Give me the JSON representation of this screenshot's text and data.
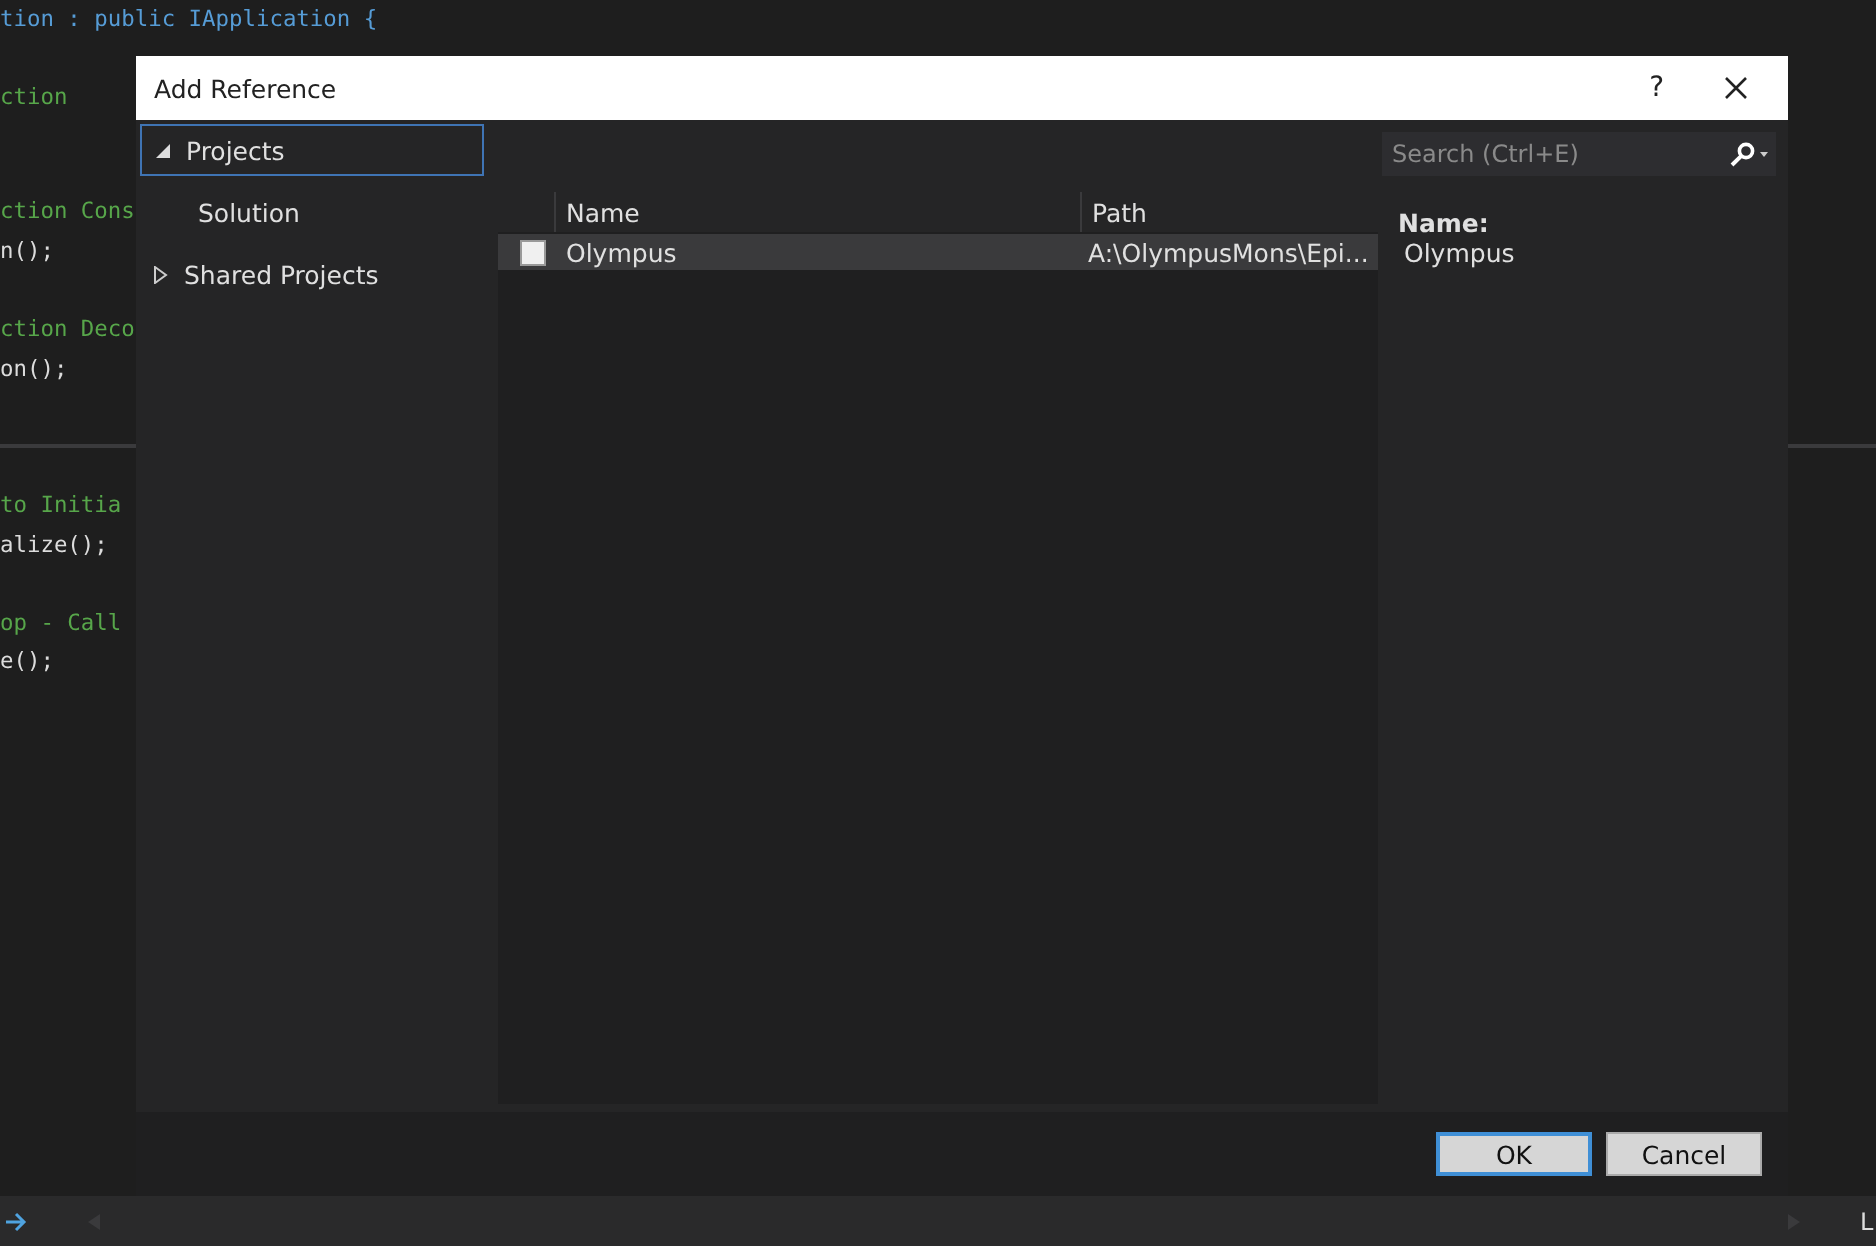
{
  "editor": {
    "blocks": [
      [
        {
          "text": "tion : public IApplication {",
          "kind": "code"
        }
      ],
      [
        {
          "text": "ction",
          "kind": "comment"
        }
      ],
      [
        {
          "text": "ction Cons",
          "kind": "comment"
        },
        {
          "text": "n();",
          "kind": "code"
        }
      ],
      [
        {
          "text": "ction Deco",
          "kind": "comment"
        },
        {
          "text": "on();",
          "kind": "code"
        }
      ],
      [
        {
          "text": "to Initia",
          "kind": "comment"
        },
        {
          "text": "alize();",
          "kind": "code"
        }
      ],
      [
        {
          "text": "op - Call",
          "kind": "comment"
        },
        {
          "text": "e();",
          "kind": "code"
        }
      ]
    ],
    "status_text": "L"
  },
  "dialog": {
    "title": "Add Reference",
    "help": "?",
    "tree": [
      {
        "label": "Projects",
        "expanded": true,
        "selected": true,
        "children": [
          {
            "label": "Solution",
            "selected": false
          }
        ]
      },
      {
        "label": "Shared Projects",
        "expanded": false,
        "selected": false
      }
    ],
    "search": {
      "placeholder": "Search (Ctrl+E)"
    },
    "table": {
      "columns": [
        "Name",
        "Path"
      ],
      "rows": [
        {
          "checked": false,
          "name": "Olympus",
          "path": "A:\\OlympusMons\\Epi..."
        }
      ]
    },
    "details": {
      "label": "Name:",
      "value": "Olympus"
    },
    "buttons": [
      {
        "label": "OK",
        "default": true
      },
      {
        "label": "Cancel",
        "default": false
      }
    ]
  }
}
